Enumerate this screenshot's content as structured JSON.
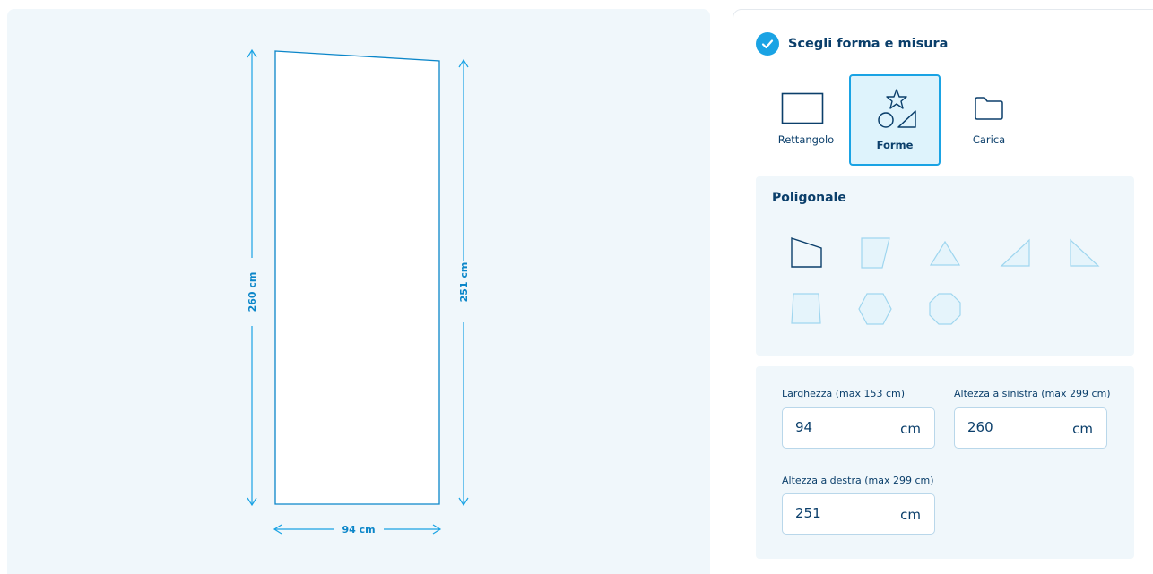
{
  "preview": {
    "left_height_label": "260 cm",
    "right_height_label": "251 cm",
    "width_label": "94 cm"
  },
  "config": {
    "step_title": "Scegli forma e misura",
    "shape_tabs": [
      {
        "label": "Rettangolo",
        "icon": "rectangle-icon",
        "active": false
      },
      {
        "label": "Forme",
        "icon": "shapes-icon",
        "active": true
      },
      {
        "label": "Carica",
        "icon": "folder-icon",
        "active": false
      }
    ],
    "polygon_section_title": "Poligonale",
    "polygon_shapes": [
      "trapezoid-right-slant",
      "parallelogram",
      "triangle",
      "right-triangle-left",
      "right-triangle-right",
      "trapezoid",
      "hexagon",
      "octagon"
    ],
    "fields": {
      "width": {
        "label": "Larghezza (max 153 cm)",
        "value": "94",
        "unit": "cm"
      },
      "left_height": {
        "label": "Altezza a sinistra (max 299 cm)",
        "value": "260",
        "unit": "cm"
      },
      "right_height": {
        "label": "Altezza a destra (max 299 cm)",
        "value": "251",
        "unit": "cm"
      }
    },
    "colors": {
      "accent": "#1aa3e4",
      "text": "#0b3f6b",
      "panel_bg": "#f0f7fb"
    }
  }
}
